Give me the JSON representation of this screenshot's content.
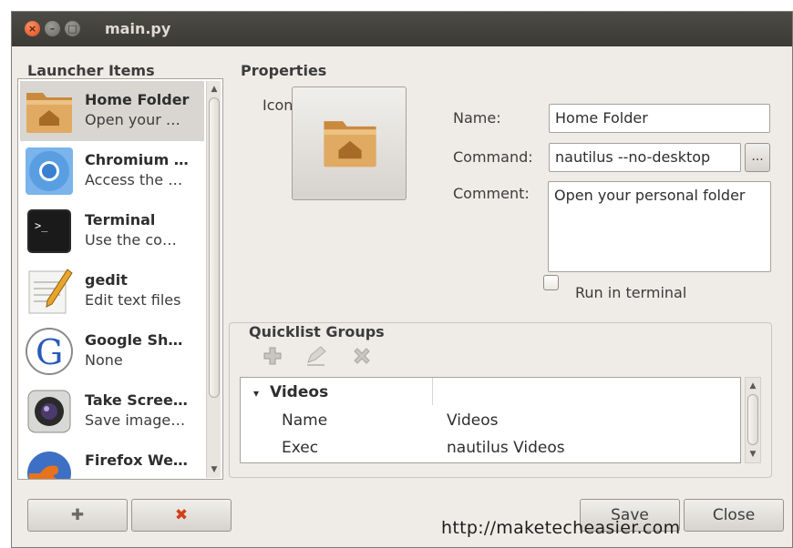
{
  "window": {
    "title": "main.py",
    "close_glyph": "×",
    "min_glyph": "–",
    "max_glyph": "□"
  },
  "launcher": {
    "heading": "Launcher Items",
    "items": [
      {
        "name": "Home Folder",
        "desc": "Open your …",
        "icon": "home-folder-icon",
        "selected": true
      },
      {
        "name": "Chromium …",
        "desc": "Access the …",
        "icon": "chromium-icon"
      },
      {
        "name": "Terminal",
        "desc": "Use the co…",
        "icon": "terminal-icon"
      },
      {
        "name": "gedit",
        "desc": "Edit text files",
        "icon": "gedit-icon"
      },
      {
        "name": "Google Sh…",
        "desc": "None",
        "icon": "google-icon"
      },
      {
        "name": "Take Scree…",
        "desc": "Save image…",
        "icon": "camera-icon"
      },
      {
        "name": "Firefox We…",
        "desc": "",
        "icon": "firefox-icon"
      }
    ],
    "add_glyph": "✚",
    "remove_glyph": "✖",
    "scroll_up": "▲",
    "scroll_down": "▼"
  },
  "properties": {
    "heading": "Properties",
    "icon_label": "Icon:",
    "name_label": "Name:",
    "name_value": "Home Folder",
    "command_label": "Command:",
    "command_value": "nautilus --no-desktop",
    "browse_label": "...",
    "comment_label": "Comment:",
    "comment_value": "Open your personal folder",
    "run_in_terminal_label": "Run in terminal",
    "run_in_terminal_checked": false
  },
  "quicklist": {
    "heading": "Quicklist Groups",
    "expander": "▾",
    "group_name": "Videos",
    "rows": [
      {
        "key": "Name",
        "value": "Videos"
      },
      {
        "key": "Exec",
        "value": "nautilus Videos"
      }
    ]
  },
  "footer": {
    "save_label": "Save",
    "close_label": "Close"
  },
  "watermark": "http://maketecheasier.com",
  "colors": {
    "titlebar": "#3b3a36",
    "window_bg": "#efebe7",
    "close_button": "#df4a16",
    "folder": "#d9a25a"
  }
}
